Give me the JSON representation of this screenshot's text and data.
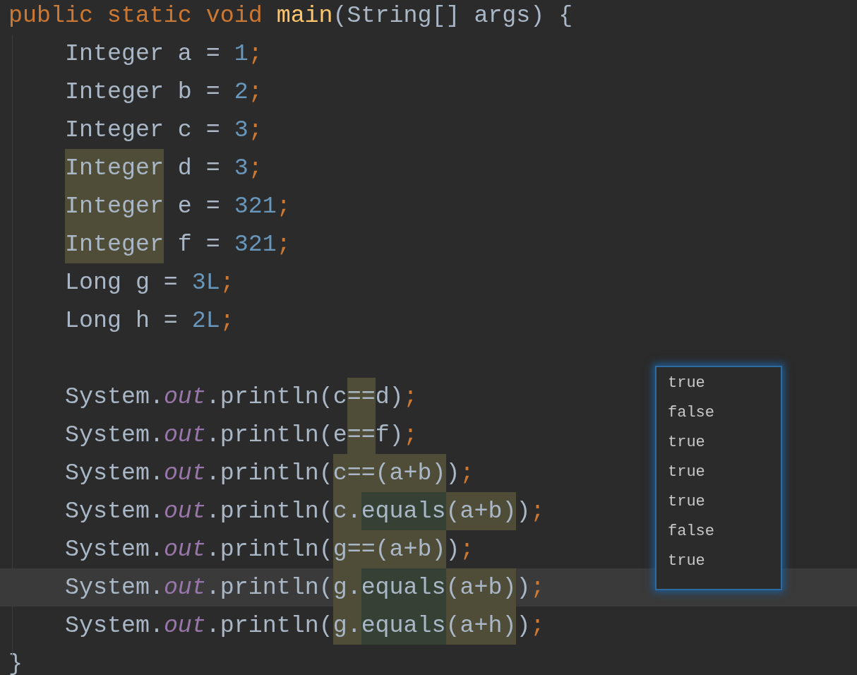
{
  "editor": {
    "lines": [
      {
        "current": false,
        "indent": false,
        "tokens": [
          {
            "text": "public static void ",
            "kind": "keyword"
          },
          {
            "text": "main",
            "kind": "method"
          },
          {
            "text": "(String[] args) {",
            "kind": "plain"
          }
        ]
      },
      {
        "current": false,
        "indent": true,
        "tokens": [
          {
            "text": "Integer a = ",
            "kind": "plain"
          },
          {
            "text": "1",
            "kind": "number"
          },
          {
            "text": ";",
            "kind": "semicolon"
          }
        ]
      },
      {
        "current": false,
        "indent": true,
        "tokens": [
          {
            "text": "Integer b = ",
            "kind": "plain"
          },
          {
            "text": "2",
            "kind": "number"
          },
          {
            "text": ";",
            "kind": "semicolon"
          }
        ]
      },
      {
        "current": false,
        "indent": true,
        "tokens": [
          {
            "text": "Integer c = ",
            "kind": "plain"
          },
          {
            "text": "3",
            "kind": "number"
          },
          {
            "text": ";",
            "kind": "semicolon"
          }
        ]
      },
      {
        "current": false,
        "indent": true,
        "tokens": [
          {
            "text": "Integer",
            "kind": "plain",
            "color": "#4f4c37"
          },
          {
            "text": " d = ",
            "kind": "plain"
          },
          {
            "text": "3",
            "kind": "number"
          },
          {
            "text": ";",
            "kind": "semicolon"
          }
        ]
      },
      {
        "current": false,
        "indent": true,
        "tokens": [
          {
            "text": "Integer",
            "kind": "plain",
            "color": "#4f4c37"
          },
          {
            "text": " e = ",
            "kind": "plain"
          },
          {
            "text": "321",
            "kind": "number"
          },
          {
            "text": ";",
            "kind": "semicolon"
          }
        ]
      },
      {
        "current": false,
        "indent": true,
        "tokens": [
          {
            "text": "Integer",
            "kind": "plain",
            "color": "#4f4c37"
          },
          {
            "text": " f = ",
            "kind": "plain"
          },
          {
            "text": "321",
            "kind": "number"
          },
          {
            "text": ";",
            "kind": "semicolon"
          }
        ]
      },
      {
        "current": false,
        "indent": true,
        "tokens": [
          {
            "text": "Long g = ",
            "kind": "plain"
          },
          {
            "text": "3L",
            "kind": "number"
          },
          {
            "text": ";",
            "kind": "semicolon"
          }
        ]
      },
      {
        "current": false,
        "indent": true,
        "tokens": [
          {
            "text": "Long h = ",
            "kind": "plain"
          },
          {
            "text": "2L",
            "kind": "number"
          },
          {
            "text": ";",
            "kind": "semicolon"
          }
        ]
      },
      {
        "current": false
      },
      {
        "current": false,
        "indent": true,
        "tokens": [
          {
            "text": "System.",
            "kind": "plain"
          },
          {
            "text": "out",
            "kind": "static-field"
          },
          {
            "text": ".println(c",
            "kind": "plain"
          },
          {
            "text": "==",
            "kind": "plain",
            "color": "#4f4c37"
          },
          {
            "text": "d)",
            "kind": "plain"
          },
          {
            "text": ";",
            "kind": "semicolon"
          }
        ]
      },
      {
        "current": false,
        "indent": true,
        "tokens": [
          {
            "text": "System.",
            "kind": "plain"
          },
          {
            "text": "out",
            "kind": "static-field"
          },
          {
            "text": ".println(e",
            "kind": "plain"
          },
          {
            "text": "==",
            "kind": "plain",
            "color": "#4f4c37"
          },
          {
            "text": "f)",
            "kind": "plain"
          },
          {
            "text": ";",
            "kind": "semicolon"
          }
        ]
      },
      {
        "current": false,
        "indent": true,
        "tokens": [
          {
            "text": "System.",
            "kind": "plain"
          },
          {
            "text": "out",
            "kind": "static-field"
          },
          {
            "text": ".println(",
            "kind": "plain"
          },
          {
            "text": "c==(a+b)",
            "kind": "plain",
            "color": "#4f4c37"
          },
          {
            "text": ")",
            "kind": "plain"
          },
          {
            "text": ";",
            "kind": "semicolon"
          }
        ]
      },
      {
        "current": false,
        "indent": true,
        "tokens": [
          {
            "text": "System.",
            "kind": "plain"
          },
          {
            "text": "out",
            "kind": "static-field"
          },
          {
            "text": ".println(",
            "kind": "plain"
          },
          {
            "text": "c.",
            "kind": "plain",
            "color": "#4f4c37"
          },
          {
            "text": "equals",
            "kind": "plain",
            "color": "#344134"
          },
          {
            "text": "(a+b)",
            "kind": "plain",
            "color": "#4f4c37"
          },
          {
            "text": ")",
            "kind": "plain"
          },
          {
            "text": ";",
            "kind": "semicolon"
          }
        ]
      },
      {
        "current": false,
        "indent": true,
        "tokens": [
          {
            "text": "System.",
            "kind": "plain"
          },
          {
            "text": "out",
            "kind": "static-field"
          },
          {
            "text": ".println(",
            "kind": "plain"
          },
          {
            "text": "g==(a+b)",
            "kind": "plain",
            "color": "#4f4c37"
          },
          {
            "text": ")",
            "kind": "plain"
          },
          {
            "text": ";",
            "kind": "semicolon"
          }
        ]
      },
      {
        "current": true,
        "indent": true,
        "tokens": [
          {
            "text": "System.",
            "kind": "plain"
          },
          {
            "text": "out",
            "kind": "static-field"
          },
          {
            "text": ".println(",
            "kind": "plain"
          },
          {
            "text": "g.",
            "kind": "plain",
            "color": "#4f4c37"
          },
          {
            "text": "equals",
            "kind": "plain",
            "color": "#344134"
          },
          {
            "text": "(a+b)",
            "kind": "plain",
            "color": "#4f4c37"
          },
          {
            "text": ")",
            "kind": "plain"
          },
          {
            "text": ";",
            "kind": "semicolon"
          }
        ]
      },
      {
        "current": false,
        "indent": true,
        "tokens": [
          {
            "text": "System.",
            "kind": "plain"
          },
          {
            "text": "out",
            "kind": "static-field"
          },
          {
            "text": ".println(",
            "kind": "plain"
          },
          {
            "text": "g.",
            "kind": "plain",
            "color": "#4f4c37"
          },
          {
            "text": "equals",
            "kind": "plain",
            "color": "#344134"
          },
          {
            "text": "(a+h)",
            "kind": "plain",
            "color": "#4f4c37"
          },
          {
            "text": ")",
            "kind": "plain"
          },
          {
            "text": ";",
            "kind": "semicolon"
          }
        ]
      },
      {
        "current": false,
        "indent": false,
        "tokens": [
          {
            "text": "}",
            "kind": "plain"
          }
        ]
      }
    ]
  },
  "output_popup": {
    "lines": [
      "true",
      "false",
      "true",
      "true",
      "true",
      "false",
      "true"
    ]
  }
}
